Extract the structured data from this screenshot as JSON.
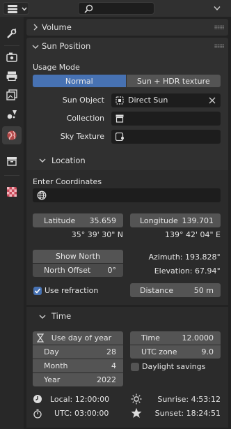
{
  "header": {
    "search_placeholder": ""
  },
  "panels": {
    "volume": {
      "title": "Volume"
    },
    "sun_position": {
      "title": "Sun Position",
      "usage_mode_label": "Usage Mode",
      "usage_modes": [
        "Normal",
        "Sun + HDR texture"
      ],
      "usage_mode_selected": "Normal",
      "sun_object_label": "Sun Object",
      "sun_object_value": "Direct Sun",
      "collection_label": "Collection",
      "collection_value": "",
      "sky_texture_label": "Sky Texture",
      "sky_texture_value": ""
    },
    "location": {
      "title": "Location",
      "enter_coordinates_label": "Enter Coordinates",
      "coordinates_value": "",
      "latitude_label": "Latitude",
      "latitude_value": "35.659",
      "latitude_dms": "35° 39' 30\" N",
      "longitude_label": "Longitude",
      "longitude_value": "139.701",
      "longitude_dms": "139° 42' 04\" E",
      "show_north_label": "Show North",
      "north_offset_label": "North Offset",
      "north_offset_value": "0°",
      "azimuth_text": "Azimuth: 193.828°",
      "elevation_text": "Elevation: 67.94°",
      "use_refraction_label": "Use refraction",
      "use_refraction_checked": true,
      "distance_label": "Distance",
      "distance_value": "50 m"
    },
    "time": {
      "title": "Time",
      "use_day_of_year_label": "Use day of year",
      "day_label": "Day",
      "day_value": "28",
      "month_label": "Month",
      "month_value": "4",
      "year_label": "Year",
      "year_value": "2022",
      "time_label": "Time",
      "time_value": "12.0000",
      "utc_zone_label": "UTC zone",
      "utc_zone_value": "9.0",
      "daylight_savings_label": "Daylight savings",
      "daylight_savings_checked": false,
      "local_text": "Local: 12:00:00",
      "utc_text": "UTC: 03:00:00",
      "sunrise_text": "Sunrise: 4:53:12",
      "sunset_text": "Sunset: 18:24:51"
    }
  },
  "colors": {
    "accent": "#4772b3",
    "panel_bg": "#303030",
    "field_bg": "#545454",
    "world_icon": "#e25a5a"
  },
  "sidebar_icons": [
    "tool-icon",
    "render-icon",
    "output-icon",
    "view-layer-icon",
    "scene-icon",
    "world-icon",
    "collection-icon",
    "texture-icon"
  ]
}
